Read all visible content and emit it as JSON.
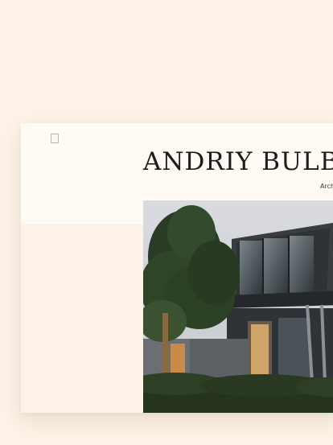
{
  "header": {
    "title": "ANDRIY BULBA",
    "subtitle": "Arch"
  },
  "logo": {
    "icon": "square-logo-icon"
  },
  "hero": {
    "image": "modern-house-photo"
  },
  "colors": {
    "background": "#fdf3e8",
    "card": "#fdf2e7",
    "header": "#fffaf4",
    "text": "#1d1c1a"
  }
}
